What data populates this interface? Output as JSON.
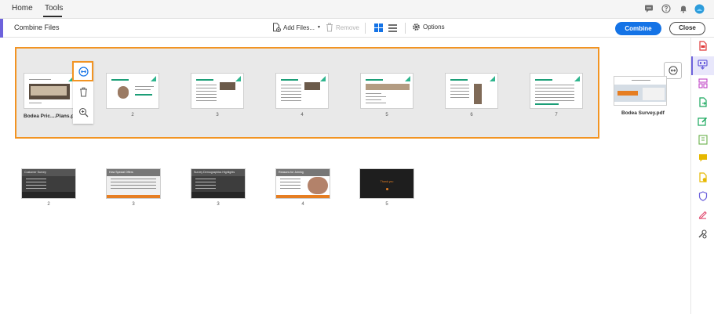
{
  "menubar": {
    "tabs": [
      {
        "label": "Home"
      },
      {
        "label": "Tools"
      }
    ],
    "icons": [
      "chat-icon",
      "help-icon",
      "bell-icon",
      "profile-avatar"
    ]
  },
  "toolbar": {
    "title": "Combine Files",
    "add_files_label": "Add Files...",
    "remove_label": "Remove",
    "options_label": "Options",
    "combine_label": "Combine",
    "close_label": "Close"
  },
  "main": {
    "group1": {
      "file_name": "Bodea Pric....Plans.pptx",
      "page_numbers": [
        "2",
        "3",
        "4",
        "5",
        "6",
        "7"
      ]
    },
    "file2": {
      "file_name": "Bodea Survey.pdf"
    },
    "group2": {
      "page_numbers": [
        "2",
        "3",
        "3",
        "4",
        "5"
      ],
      "slide_titles": [
        "Customer Survey",
        "How Special Offers",
        "Survey Demographics Highlights",
        "Reasons for Joining",
        "Thank you"
      ]
    }
  },
  "colors": {
    "accent": "#1473e6",
    "selection": "#f29423",
    "brand": "#6d62dc"
  }
}
